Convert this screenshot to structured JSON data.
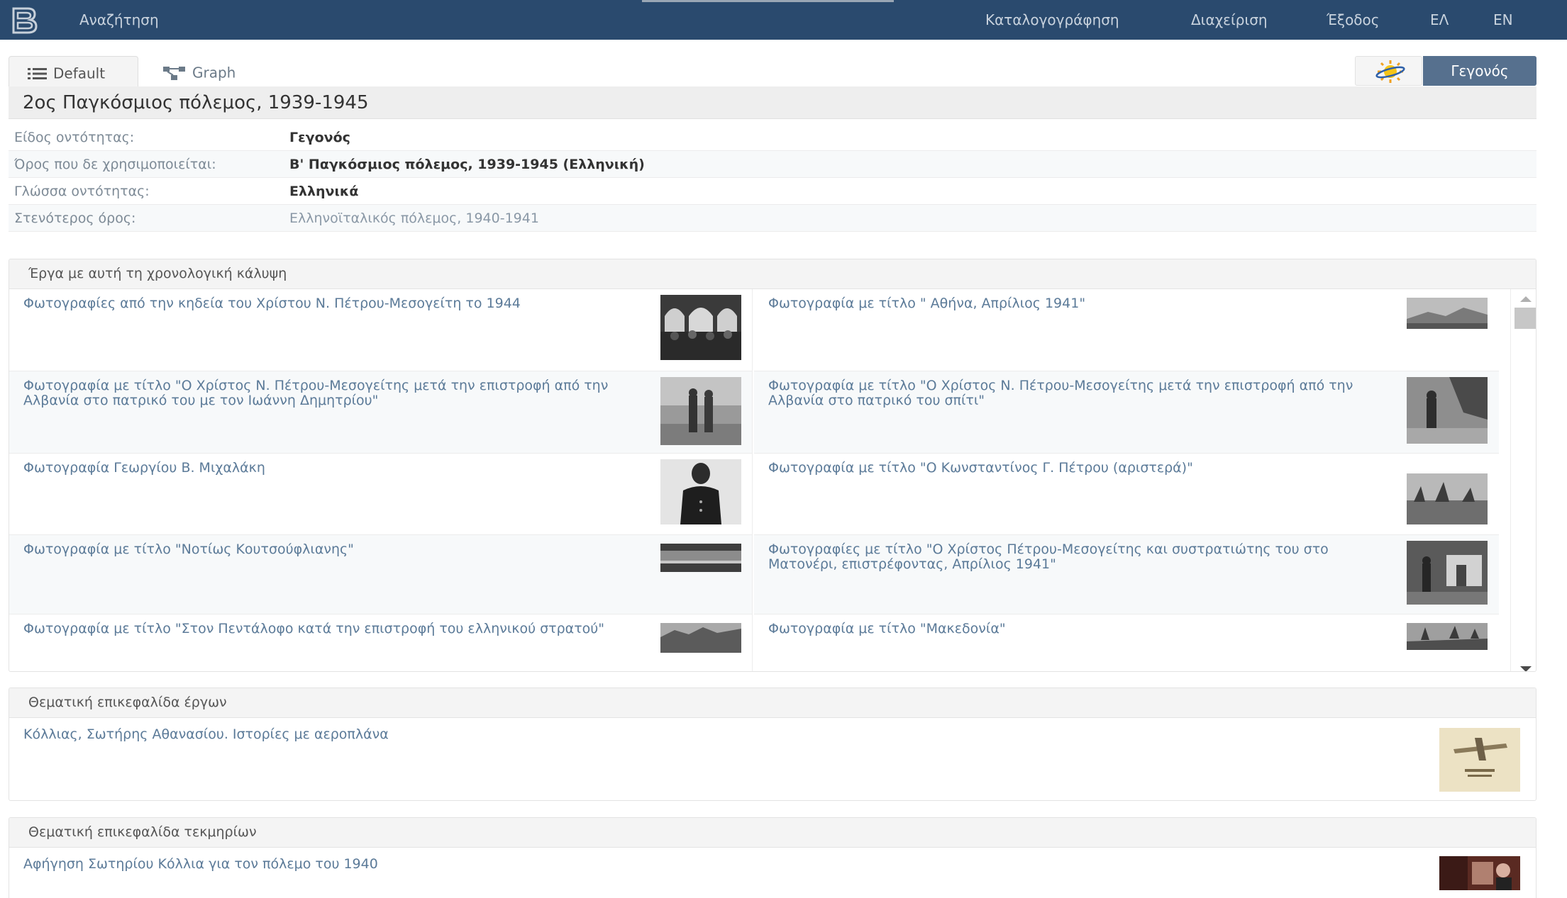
{
  "nav": {
    "brand_icon": "b-logo-icon",
    "search": "Αναζήτηση",
    "catalog": "Καταλογογράφηση",
    "admin": "Διαχείριση",
    "logout": "Έξοδος",
    "lang_el": "ΕΛ",
    "lang_en": "EN"
  },
  "tabs": {
    "default_label": "Default",
    "graph_label": "Graph",
    "type_button": "Γεγονός"
  },
  "entity": {
    "title": "2ος Παγκόσμιος πόλεμος, 1939-1945",
    "rows": [
      {
        "label": "Είδος οντότητας:",
        "value": "Γεγονός"
      },
      {
        "label": "Όρος που δε χρησιμοποιείται:",
        "value": "Β' Παγκόσμιος πόλεμος, 1939-1945 (Ελληνική)"
      },
      {
        "label": "Γλώσσα οντότητας:",
        "value": "Ελληνικά"
      },
      {
        "label": "Στενότερος όρος:",
        "value": "Ελληνοϊταλικός πόλεμος, 1940-1941"
      }
    ]
  },
  "works_panel": {
    "heading": "Έργα με αυτή τη χρονολογική κάλυψη",
    "items": [
      "Φωτογραφίες από την κηδεία του Χρίστου Ν. Πέτρου-Μεσογείτη το 1944",
      "Φωτογραφία με τίτλο \" Αθήνα, Απρίλιος 1941\"",
      "Φωτογραφία με τίτλο \"Ο Χρίστος Ν. Πέτρου-Μεσογείτης μετά την επιστροφή από την Αλβανία στο πατρικό του με τον Ιωάννη Δημητρίου\"",
      "Φωτογραφία με τίτλο \"Ο Χρίστος Ν. Πέτρου-Μεσογείτης μετά την επιστροφή από την Αλβανία στο πατρικό του σπίτι\"",
      "Φωτογραφία Γεωργίου Β. Μιχαλάκη",
      "Φωτογραφία με τίτλο \"Ο Κωνσταντίνος Γ. Πέτρου (αριστερά)\"",
      "Φωτογραφία με τίτλο \"Νοτίως Κουτσούφλιανης\"",
      "Φωτογραφίες με τίτλο \"Ο Χρίστος Πέτρου-Μεσογείτης και συστρατιώτης του στο Ματονέρι, επιστρέφοντας, Απρίλιος 1941\"",
      "Φωτογραφία με τίτλο \"Στον Πεντάλοφο κατά την επιστροφή του ελληνικού στρατού\"",
      "Φωτογραφία με τίτλο \"Μακεδονία\""
    ]
  },
  "subject_works_panel": {
    "heading": "Θεματική επικεφαλίδα έργων",
    "item": "Κόλλιας, Σωτήρης Αθανασίου. Ιστορίες με αεροπλάνα"
  },
  "subject_evidence_panel": {
    "heading": "Θεματική επικεφαλίδα τεκμηρίων",
    "item": "Αφήγηση Σωτηρίου Κόλλια για τον πόλεμο του 1940"
  },
  "colors": {
    "navbar": "#2a4a6e",
    "primary_button": "#56708e",
    "link": "#5b7a98"
  }
}
